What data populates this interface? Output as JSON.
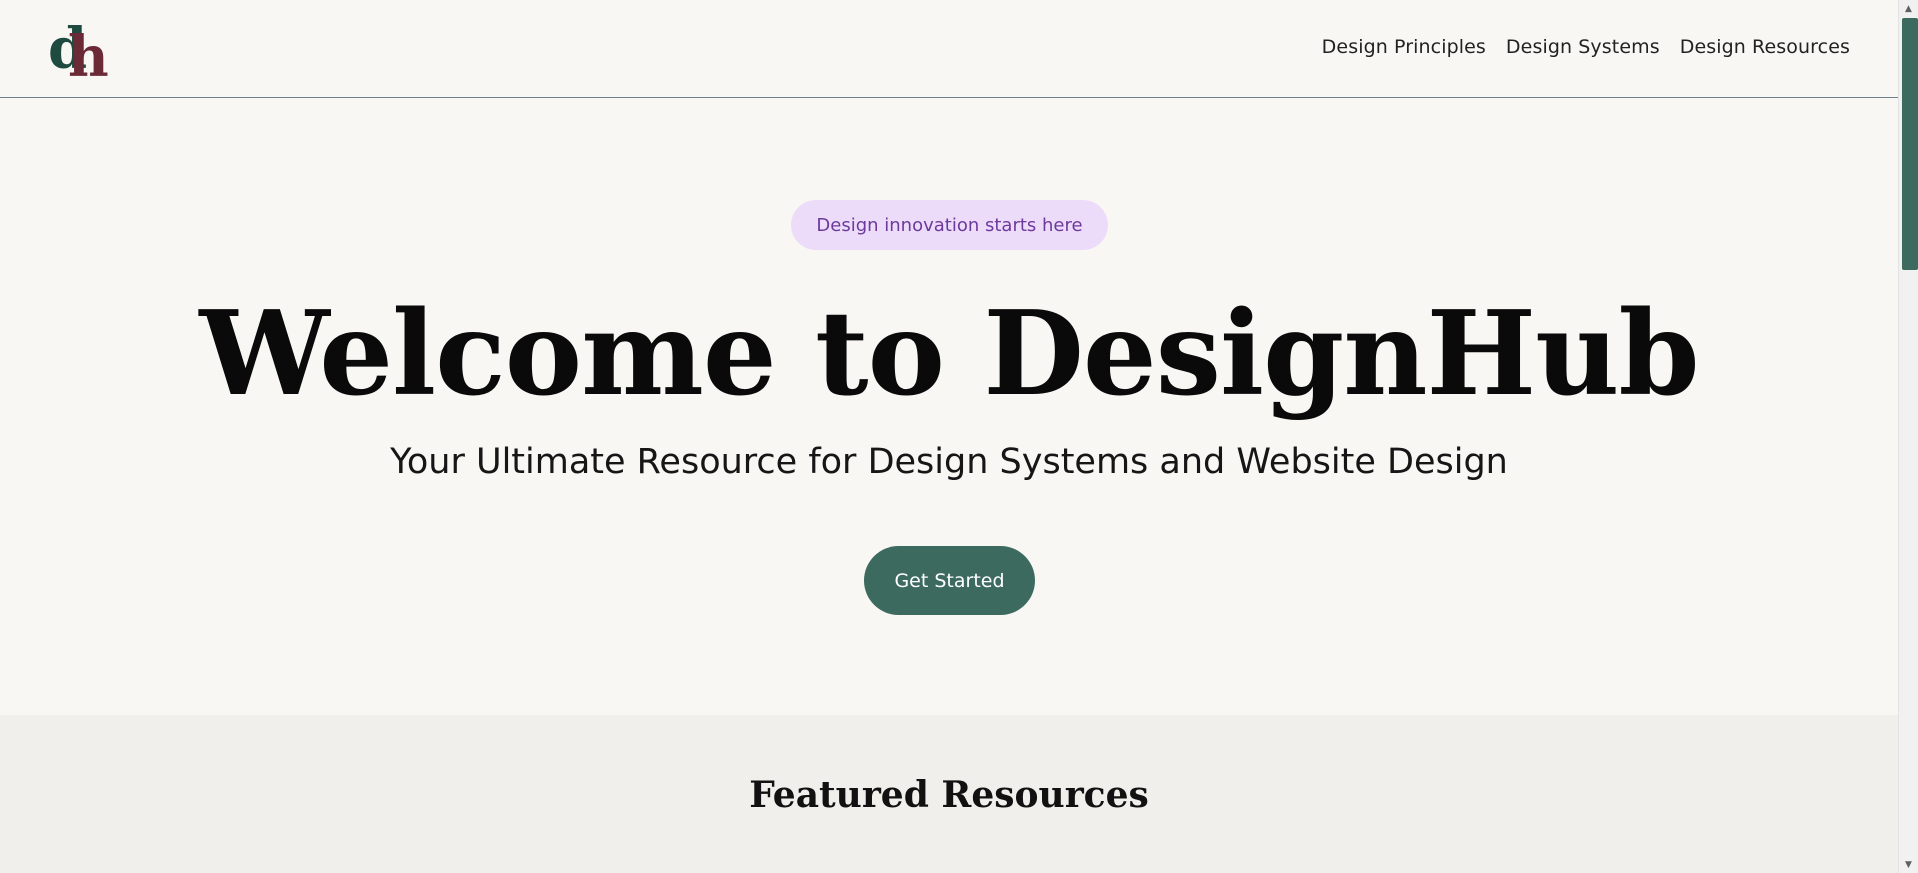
{
  "header": {
    "logo_alt": "dh",
    "nav": [
      {
        "label": "Design Principles"
      },
      {
        "label": "Design Systems"
      },
      {
        "label": "Design Resources"
      }
    ]
  },
  "hero": {
    "badge": "Design innovation starts here",
    "title": "Welcome to DesignHub",
    "subtitle": "Your Ultimate Resource for Design Systems and Website Design",
    "cta_label": "Get Started"
  },
  "featured": {
    "title": "Featured Resources"
  },
  "colors": {
    "brand_green": "#3d6a5f",
    "logo_dark_green": "#1f4a3f",
    "logo_maroon": "#6b2a35",
    "badge_bg": "#ecdcf9",
    "badge_text": "#6d3a9c",
    "page_bg": "#f9f7f4",
    "section_bg": "#f1efeb"
  },
  "icons": {
    "logo": "dh-monogram-logo",
    "scroll_up": "triangle-up-icon",
    "scroll_down": "triangle-down-icon"
  }
}
